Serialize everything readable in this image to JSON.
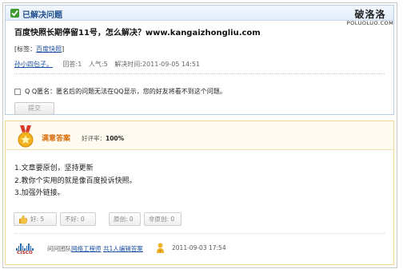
{
  "question": {
    "status_label": "已解决问题",
    "title": "百度快照长期停留11号，怎么解决？www.kangaizhongliu.com",
    "tag_prefix": "[标签：",
    "tag": "百度快照",
    "tag_suffix": "]",
    "asker": "孙小四包子。",
    "answers": "回答:1",
    "popularity": "人气:5",
    "resolved_time": "解决时间:2011-09-05 14:51",
    "qq_anonymous_label": "Q Q匿名：匿名后的问题无法在QQ显示，您的好友将看不到这个问题。",
    "submit_label": "提交"
  },
  "watermark": {
    "cn": "破洛洛",
    "en": "POLUOLUO.COM"
  },
  "answer": {
    "header_label": "满意答案",
    "rating_label": "好评率：",
    "rating_value": "100%",
    "lines": [
      "1.文章要原创，坚持更新",
      "2.教你个实用的就是像百度投诉快照。",
      "3.加强外链接。"
    ],
    "like_label": "好",
    "like_count": ": 5",
    "dislike_label": "不好: 0",
    "original_label": "原创: 0",
    "nonoriginal_label": "非原创: 0",
    "team_prefix": "问问团队",
    "team_name": "网络工程师",
    "editors_label": "共1人编辑答案",
    "answer_time": "2011-09-03 17:54",
    "footer_logo_text": "CISCO"
  },
  "colors": {
    "question_border": "#b9cde5",
    "answer_border": "#f3d58d",
    "link": "#1a4fa0",
    "accent_orange": "#d9700e"
  }
}
